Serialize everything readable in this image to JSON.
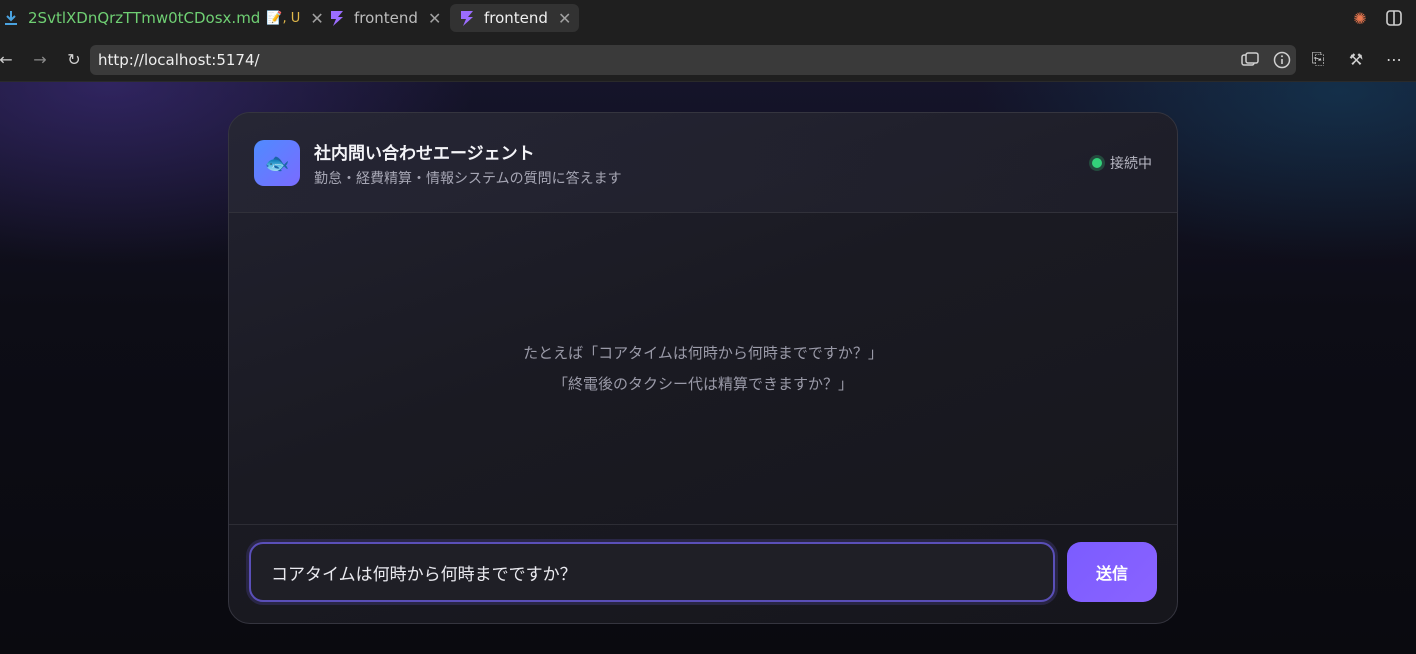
{
  "browser": {
    "tabs": [
      {
        "label": "2SvtlXDnQrzTTmw0tCDosx.md",
        "badge": "📝, U",
        "icon": "file-download-icon",
        "active": false
      },
      {
        "label": "frontend",
        "icon": "lightning-icon",
        "active": false
      },
      {
        "label": "frontend",
        "icon": "lightning-icon",
        "active": true
      }
    ],
    "url": "http://localhost:5174/"
  },
  "app": {
    "title": "社内問い合わせエージェント",
    "subtitle": "勤怠・経費精算・情報システムの質問に答えます",
    "status": "接続中",
    "logo_emoji": "🐟",
    "hint_lines": [
      "たとえば「コアタイムは何時から何時までですか？」",
      "「終電後のタクシー代は精算できますか？」"
    ],
    "input_value": "コアタイムは何時から何時までですか？",
    "send_label": "送信"
  },
  "colors": {
    "accent": "#7b5cff",
    "status_ok": "#33d17a",
    "md_tab": "#6fcf73"
  }
}
